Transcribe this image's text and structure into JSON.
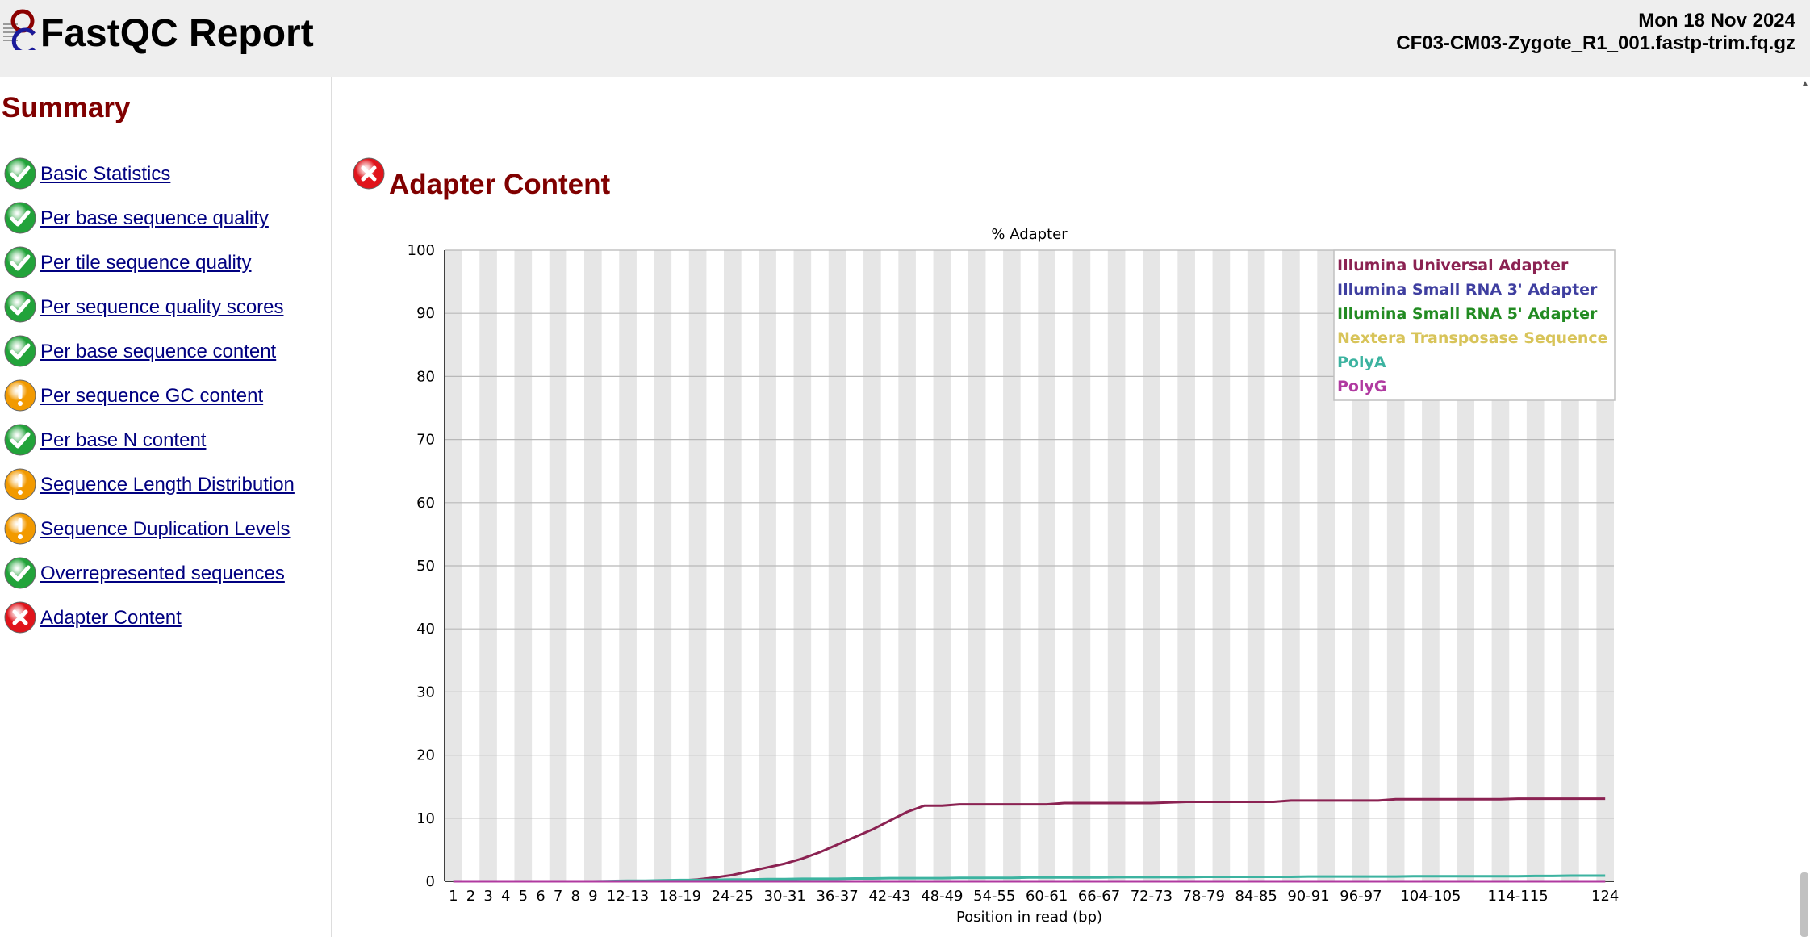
{
  "header": {
    "title": "FastQC Report",
    "date": "Mon 18 Nov 2024",
    "filename": "CF03-CM03-Zygote_R1_001.fastp-trim.fq.gz"
  },
  "summary": {
    "title": "Summary",
    "items": [
      {
        "label": "Basic Statistics",
        "status": "pass"
      },
      {
        "label": "Per base sequence quality",
        "status": "pass"
      },
      {
        "label": "Per tile sequence quality",
        "status": "pass"
      },
      {
        "label": "Per sequence quality scores",
        "status": "pass"
      },
      {
        "label": "Per base sequence content",
        "status": "pass"
      },
      {
        "label": "Per sequence GC content",
        "status": "warn"
      },
      {
        "label": "Per base N content",
        "status": "pass"
      },
      {
        "label": "Sequence Length Distribution",
        "status": "warn"
      },
      {
        "label": "Sequence Duplication Levels",
        "status": "warn"
      },
      {
        "label": "Overrepresented sequences",
        "status": "pass"
      },
      {
        "label": "Adapter Content",
        "status": "fail"
      }
    ]
  },
  "module": {
    "title": "Adapter Content",
    "status": "fail"
  },
  "colors": {
    "pass": "#22a33a",
    "warn": "#f29a00",
    "fail": "#e0141b",
    "heading": "#800000",
    "link": "#000080"
  },
  "chart_data": {
    "type": "line",
    "title": "% Adapter",
    "xlabel": "Position in read (bp)",
    "ylabel": "",
    "ylim": [
      0,
      100
    ],
    "yticks": [
      0,
      10,
      20,
      30,
      40,
      50,
      60,
      70,
      80,
      90,
      100
    ],
    "grid": true,
    "legend_position": "top-right",
    "categories": [
      "1",
      "2",
      "3",
      "4",
      "5",
      "6",
      "7",
      "8",
      "9",
      "10-11",
      "12-13",
      "14-15",
      "16-17",
      "18-19",
      "20-21",
      "22-23",
      "24-25",
      "26-27",
      "28-29",
      "30-31",
      "32-33",
      "34-35",
      "36-37",
      "38-39",
      "40-41",
      "42-43",
      "44-45",
      "46-47",
      "48-49",
      "50-51",
      "52-53",
      "54-55",
      "56-57",
      "58-59",
      "60-61",
      "62-63",
      "64-65",
      "66-67",
      "68-69",
      "70-71",
      "72-73",
      "74-75",
      "76-77",
      "78-79",
      "80-81",
      "82-83",
      "84-85",
      "86-87",
      "88-89",
      "90-91",
      "92-93",
      "94-95",
      "96-97",
      "98-99",
      "100-101",
      "102-103",
      "104-105",
      "106-107",
      "108-109",
      "110-111",
      "112-113",
      "114-115",
      "116-117",
      "118-119",
      "120-121",
      "122-123",
      "124"
    ],
    "x_tick_labels": [
      "1",
      "2",
      "3",
      "4",
      "5",
      "6",
      "7",
      "8",
      "9",
      "12-13",
      "18-19",
      "24-25",
      "30-31",
      "36-37",
      "42-43",
      "48-49",
      "54-55",
      "60-61",
      "66-67",
      "72-73",
      "78-79",
      "84-85",
      "90-91",
      "96-97",
      "104-105",
      "114-115",
      "124"
    ],
    "series": [
      {
        "name": "Illumina Universal Adapter",
        "color": "#8b2252",
        "values": [
          0,
          0,
          0,
          0,
          0,
          0,
          0,
          0,
          0,
          0,
          0,
          0,
          0,
          0.1,
          0.3,
          0.6,
          1.0,
          1.6,
          2.2,
          2.8,
          3.6,
          4.6,
          5.8,
          7.0,
          8.2,
          9.6,
          11.0,
          12.0,
          12.0,
          12.2,
          12.2,
          12.2,
          12.2,
          12.2,
          12.2,
          12.4,
          12.4,
          12.4,
          12.4,
          12.4,
          12.4,
          12.5,
          12.6,
          12.6,
          12.6,
          12.6,
          12.6,
          12.6,
          12.8,
          12.8,
          12.8,
          12.8,
          12.8,
          12.8,
          13.0,
          13.0,
          13.0,
          13.0,
          13.0,
          13.0,
          13.0,
          13.1,
          13.1,
          13.1,
          13.1,
          13.1,
          13.1
        ]
      },
      {
        "name": "Illumina Small RNA 3' Adapter",
        "color": "#3f3fa0",
        "values": [
          0,
          0,
          0,
          0,
          0,
          0,
          0,
          0,
          0,
          0,
          0,
          0,
          0,
          0,
          0,
          0,
          0,
          0,
          0,
          0,
          0,
          0,
          0,
          0,
          0,
          0,
          0,
          0,
          0,
          0,
          0,
          0,
          0,
          0,
          0,
          0,
          0,
          0,
          0,
          0,
          0,
          0,
          0,
          0,
          0,
          0,
          0,
          0,
          0,
          0,
          0,
          0,
          0,
          0,
          0,
          0,
          0,
          0,
          0,
          0,
          0,
          0,
          0,
          0,
          0,
          0,
          0
        ]
      },
      {
        "name": "Illumina Small RNA 5' Adapter",
        "color": "#228b22",
        "values": [
          0,
          0,
          0,
          0,
          0,
          0,
          0,
          0,
          0,
          0,
          0,
          0,
          0,
          0,
          0,
          0,
          0,
          0,
          0,
          0,
          0,
          0,
          0,
          0,
          0,
          0,
          0,
          0,
          0,
          0,
          0,
          0,
          0,
          0,
          0,
          0,
          0,
          0,
          0,
          0,
          0,
          0,
          0,
          0,
          0,
          0,
          0,
          0,
          0,
          0,
          0,
          0,
          0,
          0,
          0,
          0,
          0,
          0,
          0,
          0,
          0,
          0,
          0,
          0,
          0,
          0,
          0
        ]
      },
      {
        "name": "Nextera Transposase Sequence",
        "color": "#d8c45a",
        "values": [
          0,
          0,
          0,
          0,
          0,
          0,
          0,
          0,
          0,
          0,
          0,
          0,
          0,
          0,
          0,
          0,
          0,
          0,
          0,
          0,
          0,
          0,
          0,
          0,
          0,
          0,
          0,
          0,
          0,
          0,
          0,
          0,
          0,
          0,
          0,
          0,
          0,
          0,
          0,
          0,
          0,
          0,
          0,
          0,
          0,
          0,
          0,
          0,
          0,
          0,
          0,
          0,
          0,
          0,
          0,
          0,
          0,
          0,
          0,
          0,
          0,
          0,
          0,
          0,
          0,
          0,
          0
        ]
      },
      {
        "name": "PolyA",
        "color": "#3cb3a0",
        "values": [
          0,
          0,
          0,
          0,
          0,
          0,
          0,
          0,
          0,
          0.05,
          0.1,
          0.1,
          0.15,
          0.2,
          0.2,
          0.25,
          0.3,
          0.3,
          0.35,
          0.35,
          0.4,
          0.4,
          0.4,
          0.45,
          0.45,
          0.5,
          0.5,
          0.5,
          0.5,
          0.55,
          0.55,
          0.55,
          0.55,
          0.6,
          0.6,
          0.6,
          0.6,
          0.6,
          0.65,
          0.65,
          0.65,
          0.65,
          0.65,
          0.7,
          0.7,
          0.7,
          0.7,
          0.7,
          0.7,
          0.75,
          0.75,
          0.75,
          0.75,
          0.75,
          0.75,
          0.8,
          0.8,
          0.8,
          0.8,
          0.8,
          0.8,
          0.8,
          0.85,
          0.85,
          0.9,
          0.9,
          0.9
        ]
      },
      {
        "name": "PolyG",
        "color": "#b03aa0",
        "values": [
          0,
          0,
          0,
          0,
          0,
          0,
          0,
          0,
          0,
          0,
          0,
          0,
          0,
          0,
          0,
          0,
          0,
          0,
          0,
          0,
          0,
          0,
          0,
          0,
          0,
          0,
          0,
          0,
          0,
          0,
          0,
          0,
          0,
          0,
          0,
          0,
          0,
          0,
          0,
          0,
          0,
          0,
          0,
          0,
          0,
          0,
          0,
          0,
          0,
          0,
          0,
          0,
          0,
          0,
          0,
          0,
          0,
          0,
          0,
          0,
          0,
          0,
          0,
          0,
          0,
          0,
          0
        ]
      }
    ]
  }
}
